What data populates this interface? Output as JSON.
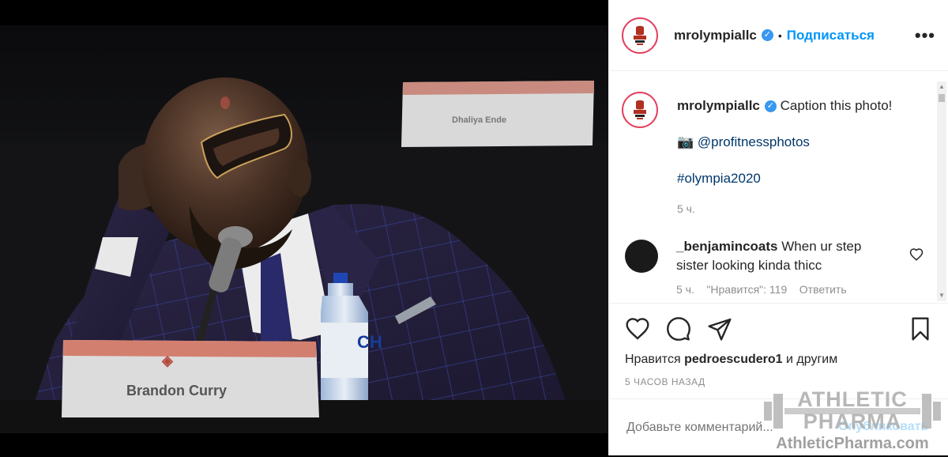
{
  "post": {
    "username": "mrolympiallc",
    "follow_label": "Подписаться",
    "more_label": "•••",
    "photo": {
      "name_card": "Brandon Curry",
      "back_card": "Dhaliya Ende"
    },
    "caption": {
      "username": "mrolympiallc",
      "text": "Caption this photo!",
      "credit_emoji": "📷",
      "credit_link": "@profitnessphotos",
      "hashtag": "#olympia2020",
      "time": "5 ч."
    },
    "comment": {
      "username": "_benjamincoats",
      "text": "When ur step sister looking kinda thicc",
      "meta": "5 ч.    \"Нравится\": 119    Ответить"
    },
    "likes": {
      "prefix": "Нравится",
      "user": "pedroescudero1",
      "suffix": "и другим"
    },
    "posted_time": "5 ЧАСОВ НАЗАД",
    "add_comment_placeholder": "Добавьте комментарий...",
    "publish_label": "Опубликовать"
  },
  "icons": [
    "heart-icon",
    "comment-icon",
    "share-icon",
    "bookmark-icon",
    "more-icon",
    "verified-badge-icon"
  ],
  "watermark": {
    "line1": "ATHLETIC",
    "line2": "PHARMA",
    "url": "AthleticPharma.com"
  },
  "colors": {
    "link": "#00376b",
    "follow": "#0095f6",
    "verified": "#3897f0",
    "meta": "#8e8e8e",
    "publish_disabled": "#b2dffc"
  }
}
